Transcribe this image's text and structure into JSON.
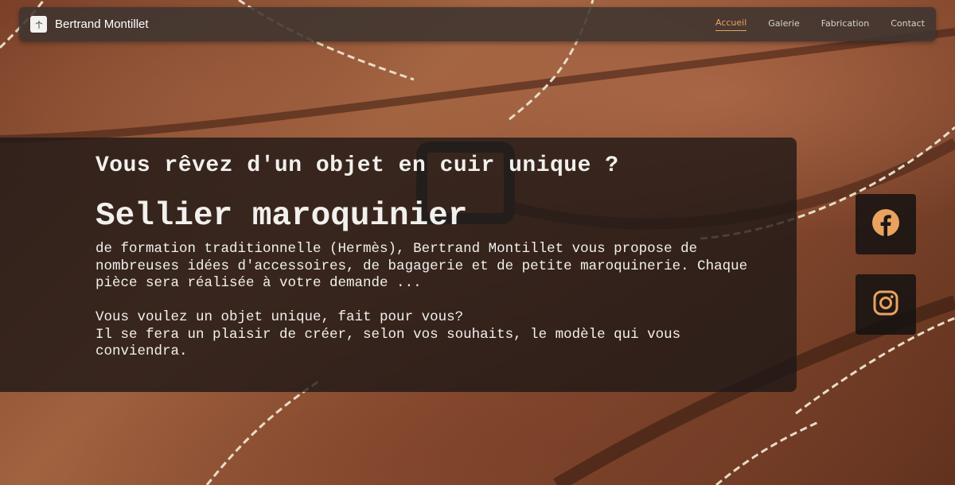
{
  "header": {
    "brand_name": "Bertrand Montillet",
    "nav": [
      {
        "label": "Accueil",
        "active": true
      },
      {
        "label": "Galerie",
        "active": false
      },
      {
        "label": "Fabrication",
        "active": false
      },
      {
        "label": "Contact",
        "active": false
      }
    ]
  },
  "hero": {
    "subtitle": "Vous rêvez d'un objet en cuir unique ?",
    "title": "Sellier maroquinier",
    "paragraph1": "de formation traditionnelle (Hermès), Bertrand Montillet vous propose de nombreuses idées d'accessoires, de bagagerie et de petite maroquinerie. Chaque pièce sera réalisée à votre demande ...",
    "paragraph2_line1": "Vous voulez un objet unique, fait pour vous?",
    "paragraph2_line2": "Il se fera un plaisir de créer, selon vos souhaits, le modèle qui vous conviendra."
  },
  "social": {
    "facebook_icon": "facebook-icon",
    "instagram_icon": "instagram-icon"
  },
  "colors": {
    "accent": "#e9a35f",
    "navbar": "#3e3430",
    "panel": "#1e1816"
  }
}
